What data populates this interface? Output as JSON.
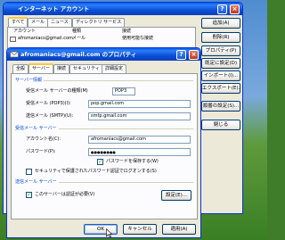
{
  "back_window": {
    "title": "インターネット アカウント",
    "tabs": [
      "すべて",
      "メール",
      "ニュース",
      "ディレクトリ サービス"
    ],
    "columns": [
      "アカウント",
      "種類",
      "接続"
    ],
    "row": {
      "account": "afromaniacs@gmail.com",
      "type": "メール",
      "connection": "使用可能な接続"
    },
    "buttons": [
      "追加(A)",
      "削除(R)",
      "プロパティ(P)",
      "既定に設定(D)",
      "インポート(I)...",
      "エクスポート(E)...",
      "順番の設定(S)...",
      "閉じる"
    ]
  },
  "dialog": {
    "title": "afromaniacs@gmail.com のプロパティ",
    "tabs": [
      "全般",
      "サーバー",
      "接続",
      "セキュリティ",
      "詳細設定"
    ],
    "active_tab": "サーバー",
    "server_info": {
      "heading": "サーバー情報",
      "incoming_type_label": "受信メール サーバーの種類(M)",
      "incoming_type_value": "POP3",
      "incoming_label": "受信メール (POP3)(I):",
      "incoming_value": "pop.gmail.com",
      "outgoing_label": "送信メール (SMTP)(U):",
      "outgoing_value": "smtp.gmail.com"
    },
    "incoming_server": {
      "heading": "受信メール サーバー",
      "account_label": "アカウント名(C):",
      "account_value": "afromaniacs@gmail.com",
      "password_label": "パスワード(P):",
      "password_value": "●●●●●●●●",
      "remember_label": "パスワードを保存する(W)",
      "spa_label": "セキュリティで保護されたパスワード認証でログオンする(S)"
    },
    "outgoing_server": {
      "heading": "送信メール サーバー",
      "auth_label": "このサーバーは認証が必要(V)",
      "settings_button": "設定(E)..."
    },
    "buttons": {
      "ok": "OK",
      "cancel": "キャンセル",
      "apply": "適用(A)"
    }
  }
}
